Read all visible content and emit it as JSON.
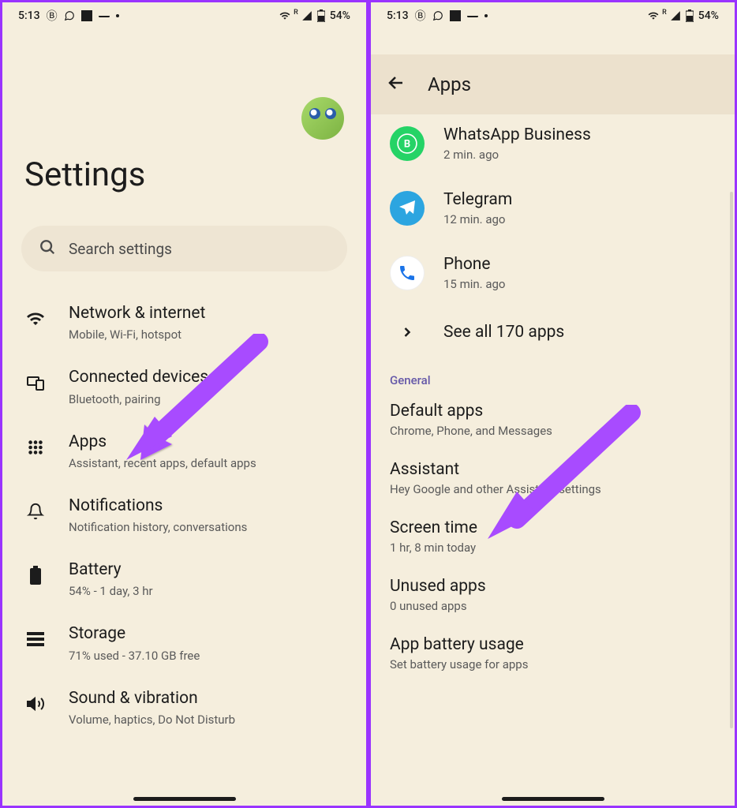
{
  "status": {
    "time": "5:13",
    "battery": "54%"
  },
  "left": {
    "title": "Settings",
    "search_placeholder": "Search settings",
    "items": [
      {
        "title": "Network & internet",
        "sub": "Mobile, Wi-Fi, hotspot"
      },
      {
        "title": "Connected devices",
        "sub": "Bluetooth, pairing"
      },
      {
        "title": "Apps",
        "sub": "Assistant, recent apps, default apps"
      },
      {
        "title": "Notifications",
        "sub": "Notification history, conversations"
      },
      {
        "title": "Battery",
        "sub": "54% - 1 day, 3 hr"
      },
      {
        "title": "Storage",
        "sub": "71% used - 37.10 GB free"
      },
      {
        "title": "Sound & vibration",
        "sub": "Volume, haptics, Do Not Disturb"
      }
    ]
  },
  "right": {
    "header": "Apps",
    "truncated": "",
    "recent": [
      {
        "name": "WhatsApp Business",
        "sub": "2 min. ago"
      },
      {
        "name": "Telegram",
        "sub": "12 min. ago"
      },
      {
        "name": "Phone",
        "sub": "15 min. ago"
      }
    ],
    "see_all": "See all 170 apps",
    "section": "General",
    "general": [
      {
        "title": "Default apps",
        "sub": "Chrome, Phone, and Messages"
      },
      {
        "title": "Assistant",
        "sub": "Hey Google and other Assistant settings"
      },
      {
        "title": "Screen time",
        "sub": "1 hr, 8 min today"
      },
      {
        "title": "Unused apps",
        "sub": "0 unused apps"
      },
      {
        "title": "App battery usage",
        "sub": "Set battery usage for apps"
      }
    ]
  }
}
